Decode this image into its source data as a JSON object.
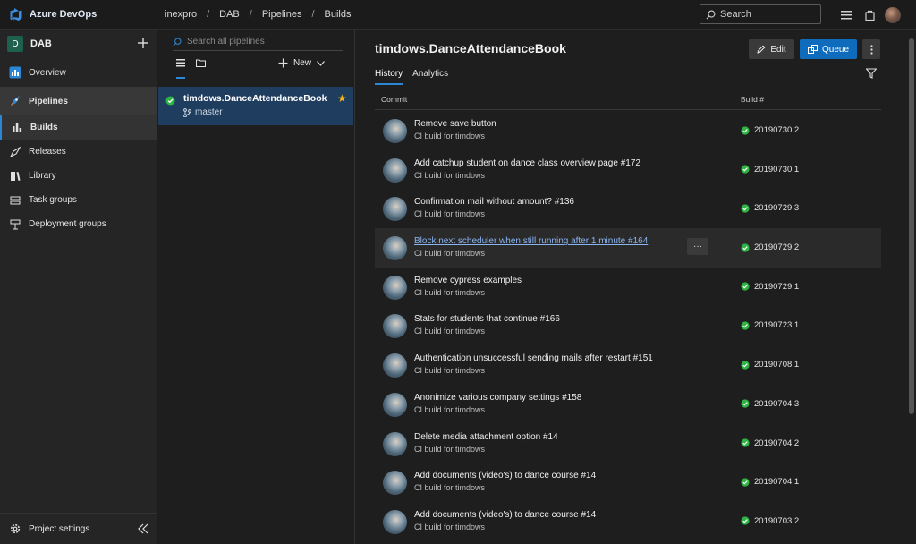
{
  "topbar": {
    "brand": "Azure DevOps",
    "breadcrumb": [
      "inexpro",
      "DAB",
      "Pipelines",
      "Builds"
    ],
    "search_label": "Search"
  },
  "project": {
    "badge": "D",
    "name": "DAB"
  },
  "nav": {
    "overview": "Overview",
    "pipelines": "Pipelines",
    "builds": "Builds",
    "releases": "Releases",
    "library": "Library",
    "task_groups": "Task groups",
    "deployment_groups": "Deployment groups",
    "project_settings": "Project settings"
  },
  "list": {
    "search_placeholder": "Search all pipelines",
    "new_label": "New",
    "pipeline": {
      "name": "timdows.DanceAttendanceBook",
      "branch": "master"
    }
  },
  "main": {
    "title": "timdows.DanceAttendanceBook",
    "edit_label": "Edit",
    "queue_label": "Queue",
    "tabs": [
      {
        "label": "History"
      },
      {
        "label": "Analytics"
      }
    ],
    "col_commit": "Commit",
    "col_build": "Build #",
    "rows": [
      {
        "title": "Remove save button",
        "sub": "CI build for timdows",
        "build": "20190730.2"
      },
      {
        "title": "Add catchup student on dance class overview page #172",
        "sub": "CI build for timdows",
        "build": "20190730.1"
      },
      {
        "title": "Confirmation mail without amount? #136",
        "sub": "CI build for timdows",
        "build": "20190729.3"
      },
      {
        "title": "Block next scheduler when still running after 1 minute #164",
        "sub": "CI build for timdows",
        "build": "20190729.2",
        "more": "···"
      },
      {
        "title": "Remove cypress examples",
        "sub": "CI build for timdows",
        "build": "20190729.1"
      },
      {
        "title": "Stats for students that continue #166",
        "sub": "CI build for timdows",
        "build": "20190723.1"
      },
      {
        "title": "Authentication unsuccessful sending mails after restart #151",
        "sub": "CI build for timdows",
        "build": "20190708.1"
      },
      {
        "title": "Anonimize various company settings #158",
        "sub": "CI build for timdows",
        "build": "20190704.3"
      },
      {
        "title": "Delete media attachment option #14",
        "sub": "CI build for timdows",
        "build": "20190704.2"
      },
      {
        "title": "Add documents (video's) to dance course #14",
        "sub": "CI build for timdows",
        "build": "20190704.1"
      },
      {
        "title": "Add documents (video's) to dance course #14",
        "sub": "CI build for timdows",
        "build": "20190703.2"
      }
    ]
  },
  "colors": {
    "accent": "#2b86d6",
    "success": "#2fb344",
    "selected": "#1f3d5f",
    "star": "#f2b417"
  }
}
